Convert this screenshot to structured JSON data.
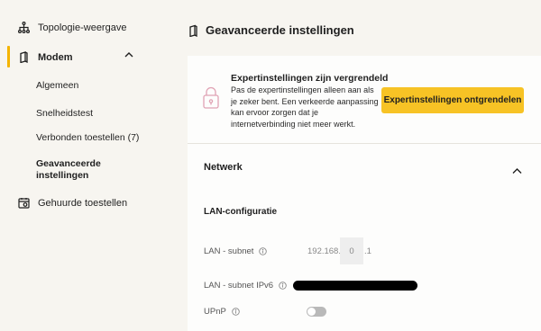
{
  "sidebar": {
    "items": [
      {
        "label": "Topologie-weergave",
        "icon": "topology-icon"
      },
      {
        "label": "Modem",
        "icon": "modem-icon",
        "expanded": true
      },
      {
        "label": "Gehuurde toestellen",
        "icon": "rented-devices-icon"
      }
    ],
    "sub_items": [
      {
        "label": "Algemeen"
      },
      {
        "label": "Snelheidstest"
      },
      {
        "label": "Verbonden toestellen (7)"
      },
      {
        "label": "Geavanceerde instellingen"
      }
    ]
  },
  "header": {
    "title": "Geavanceerde instellingen"
  },
  "lock": {
    "title": "Expertinstellingen zijn vergrendeld",
    "text": "Pas de expertinstellingen alleen aan als je zeker bent. Een verkeerde aanpassing kan ervoor zorgen dat je internetverbinding niet meer werkt.",
    "button": "Expertinstellingen ontgrendelen"
  },
  "network": {
    "title": "Netwerk",
    "lan_heading": "LAN-configuratie",
    "lan_subnet_label": "LAN - subnet",
    "lan_prefix": "192.168.",
    "lan_octet": "0",
    "lan_suffix": ".1",
    "ipv6_label": "LAN - subnet IPv6",
    "upnp_label": "UPnP",
    "upnp_enabled": false
  },
  "colors": {
    "accent": "#f7c325",
    "active_bar": "#f4b400",
    "lock_icon": "#e0a3b4"
  }
}
